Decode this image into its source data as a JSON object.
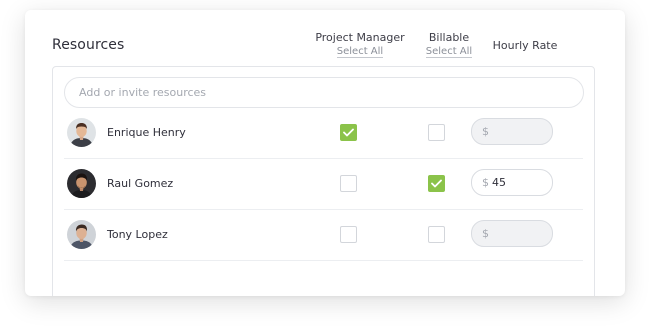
{
  "section": {
    "title": "Resources"
  },
  "columns": {
    "project_manager": {
      "label": "Project Manager",
      "action": "Select All"
    },
    "billable": {
      "label": "Billable",
      "action": "Select All"
    },
    "hourly_rate": {
      "label": "Hourly Rate"
    }
  },
  "search": {
    "placeholder": "Add or invite resources",
    "value": ""
  },
  "currency_symbol": "$",
  "accent_color": "#8bc34a",
  "resources": [
    {
      "name": "Enrique Henry",
      "project_manager": true,
      "billable": false,
      "rate": ""
    },
    {
      "name": "Raul Gomez",
      "project_manager": false,
      "billable": true,
      "rate": "45"
    },
    {
      "name": "Tony Lopez",
      "project_manager": false,
      "billable": false,
      "rate": ""
    }
  ]
}
